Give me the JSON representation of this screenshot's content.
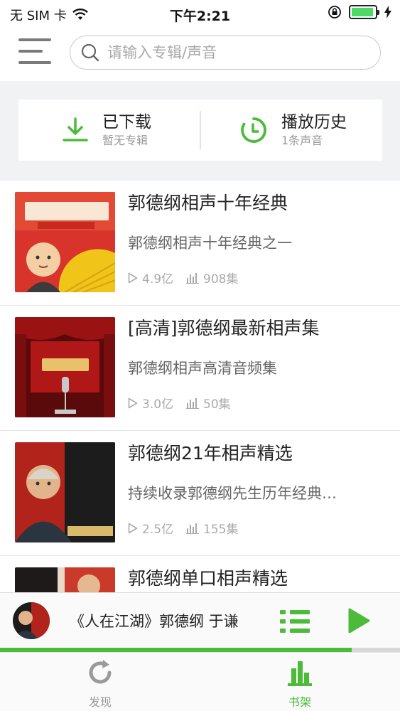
{
  "status_bar": {
    "carrier": "无 SIM 卡",
    "time": "下午2:21",
    "battery_level": 0.95
  },
  "header": {
    "menu_icon": "hamburger-menu-icon",
    "search": {
      "placeholder": "请输入专辑/声音",
      "value": ""
    }
  },
  "quick_access": {
    "downloaded": {
      "title": "已下载",
      "subtitle": "暂无专辑",
      "icon": "download-icon"
    },
    "history": {
      "title": "播放历史",
      "subtitle": "1条声音",
      "icon": "history-clock-icon"
    }
  },
  "albums": [
    {
      "title": "郭德纲相声十年经典",
      "description": "郭德纲相声十年经典之一",
      "plays": "4.9亿",
      "episodes": "908集"
    },
    {
      "title": "[高清]郭德纲最新相声集",
      "description": "郭德纲相声高清音频集",
      "plays": "3.0亿",
      "episodes": "50集"
    },
    {
      "title": "郭德纲21年相声精选",
      "description": "持续收录郭德纲先生历年经典…",
      "plays": "2.5亿",
      "episodes": "155集"
    },
    {
      "title": "郭德纲单口相声精选",
      "description": "",
      "plays": "",
      "episodes": ""
    }
  ],
  "player": {
    "title": "《人在江湖》郭德纲 于谦",
    "progress": 0.88
  },
  "tabs": [
    {
      "label": "发现",
      "icon": "refresh-discover-icon",
      "active": false
    },
    {
      "label": "书架",
      "icon": "bookshelf-chart-icon",
      "active": true
    }
  ],
  "colors": {
    "accent": "#4cbb3a",
    "inactive": "#9a9a9a",
    "band": "#f1f2f4"
  }
}
